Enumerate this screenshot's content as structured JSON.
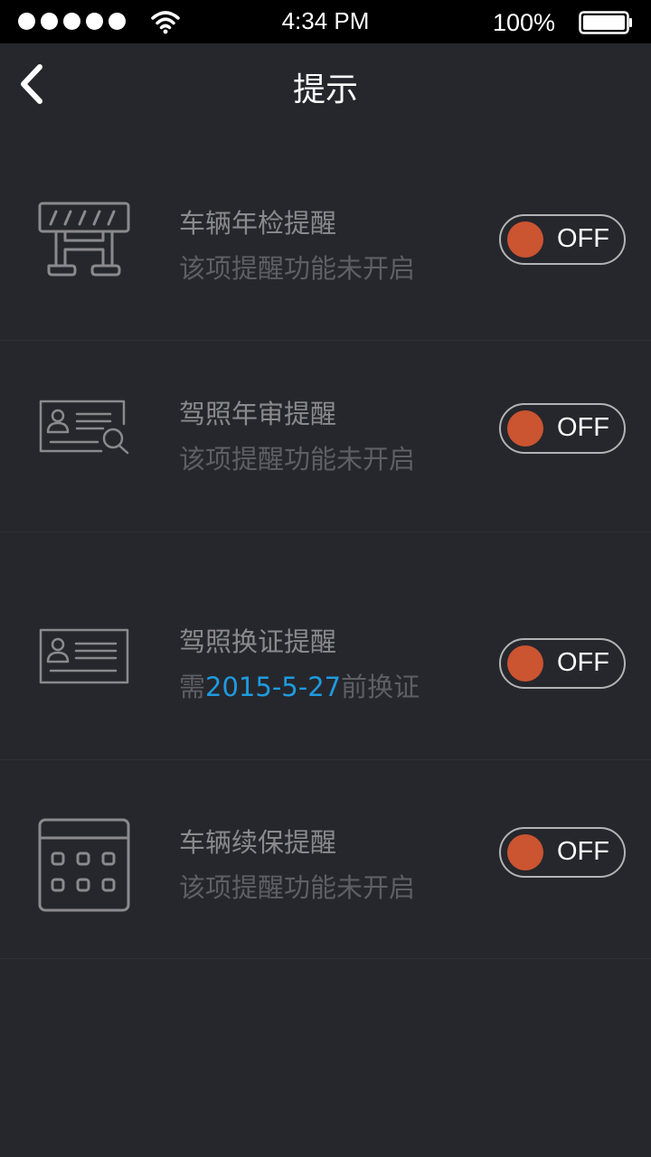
{
  "status_bar": {
    "time": "4:34 PM",
    "battery": "100%",
    "signal_icon": "signal-dots-icon",
    "wifi_icon": "wifi-icon",
    "battery_icon": "battery-icon"
  },
  "nav": {
    "title": "提示",
    "back_icon": "chevron-left-icon"
  },
  "items": [
    {
      "title": "车辆年检提醒",
      "subtitle": "该项提醒功能未开启",
      "toggle_label": "OFF",
      "icon": "barrier-icon"
    },
    {
      "title": "驾照年审提醒",
      "subtitle": "该项提醒功能未开启",
      "toggle_label": "OFF",
      "icon": "license-search-icon"
    },
    {
      "title": "驾照换证提醒",
      "subtitle_prefix": "需",
      "subtitle_date": "2015-5-27",
      "subtitle_suffix": "前换证",
      "toggle_label": "OFF",
      "icon": "license-card-icon"
    },
    {
      "title": "车辆续保提醒",
      "subtitle": "该项提醒功能未开启",
      "toggle_label": "OFF",
      "icon": "calendar-icon"
    }
  ],
  "colors": {
    "background": "#26272c",
    "knob": "#cb5431",
    "date_accent": "#1e9be0"
  }
}
